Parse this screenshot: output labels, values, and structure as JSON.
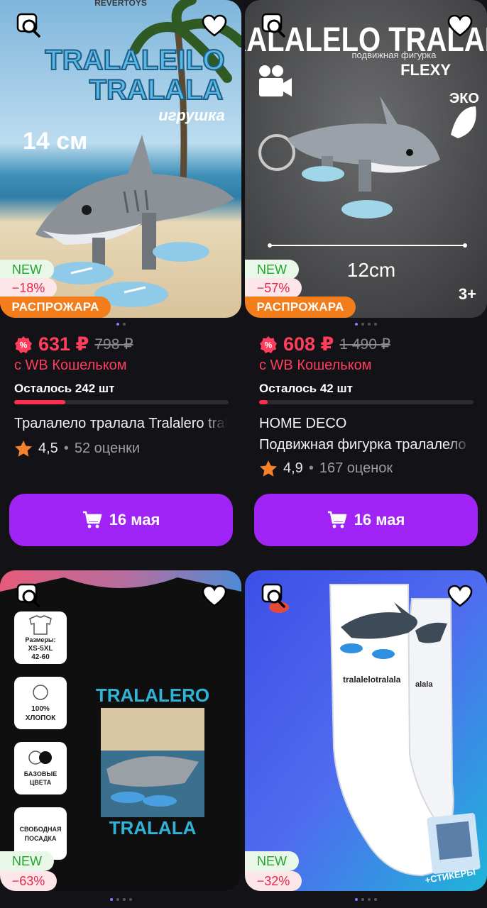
{
  "products": [
    {
      "image_text": {
        "logo": "REVERTOYS",
        "line1": "TRALALEILO",
        "line2": "TRALALA",
        "tag": "игрушка",
        "size": "14 см"
      },
      "badge_new": "NEW",
      "badge_discount": "−18%",
      "badge_sale": "РАСПРОЖАРА",
      "price_now": "631 ₽",
      "price_old": "798 ₽",
      "wallet": "с WB Кошельком",
      "stock": "Осталось 242 шт",
      "stock_fraction": 0.24,
      "title": "Тралалело тралала Tralalero tralala",
      "rating": "4,5",
      "rating_count": "52 оценки",
      "buy_label": "16 мая"
    },
    {
      "image_text": {
        "line1": "TRALALELO TRALALA",
        "sub": "подвижная фигурка",
        "flexy": "FLEXY",
        "eco": "ЭКО",
        "measure": "12cm",
        "age": "3+"
      },
      "badge_new": "NEW",
      "badge_discount": "−57%",
      "badge_sale": "РАСПРОЖАРА",
      "price_now": "608 ₽",
      "price_old": "1 490 ₽",
      "wallet": "с WB Кошельком",
      "stock": "Осталось 42 шт",
      "stock_fraction": 0.04,
      "brand": "HOME DECO",
      "title": "Подвижная фигурка тралалело",
      "rating": "4,9",
      "rating_count": "167 оценок",
      "buy_label": "16 мая"
    },
    {
      "image_text": {
        "top": "TRALALERO",
        "bottom": "TRALALA",
        "f1a": "Размеры:",
        "f1b": "XS-5XL",
        "f1c": "42-60",
        "f2a": "100%",
        "f2b": "ХЛОПОК",
        "f3a": "БАЗОВЫЕ",
        "f3b": "ЦВЕТА",
        "f4a": "СВОБОДНАЯ",
        "f4b": "ПОСАДКА"
      },
      "badge_new": "NEW",
      "badge_discount": "−63%"
    },
    {
      "image_text": {
        "sock": "tralalelotralala",
        "sock2": "alala",
        "stickers": "+СТИКЕРЫ"
      },
      "badge_new": "NEW",
      "badge_discount": "−32%"
    }
  ],
  "colors": {
    "accent": "#a024f6",
    "price": "#ff3d5c",
    "sale": "#f47d1b",
    "star": "#f5822a"
  },
  "icons": [
    "similar-search-icon",
    "heart-icon",
    "cart-icon",
    "star-icon",
    "discount-icon"
  ]
}
